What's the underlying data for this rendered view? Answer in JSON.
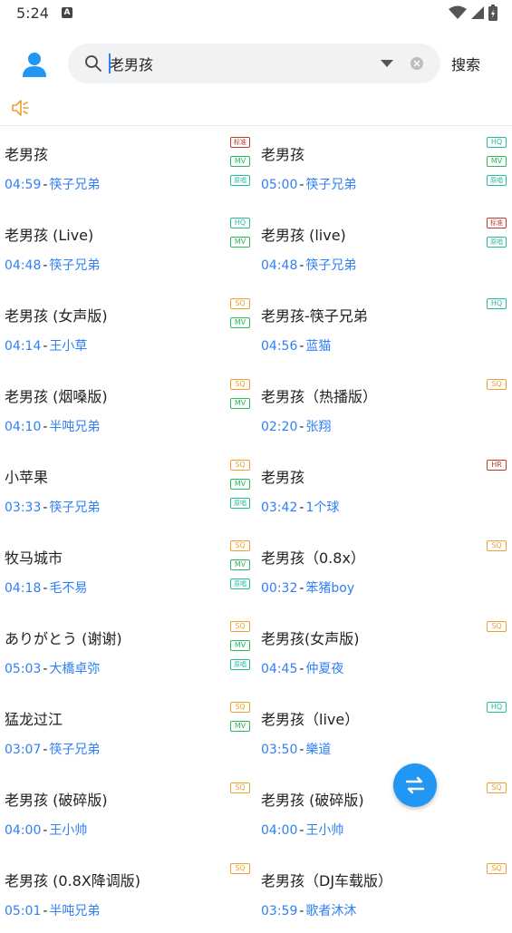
{
  "status_bar": {
    "time": "5:24",
    "notification_letter": "A"
  },
  "search": {
    "query": "老男孩",
    "button_label": "搜索"
  },
  "colors": {
    "accent": "#2f7ff5",
    "fab": "#2196f3"
  },
  "songs": [
    {
      "title": "老男孩",
      "duration": "04:59",
      "artist": "筷子兄弟",
      "badges": [
        [
          "std",
          "标准"
        ],
        [
          "mv",
          "MV"
        ],
        [
          "orig",
          "原唱"
        ]
      ]
    },
    {
      "title": "老男孩",
      "duration": "05:00",
      "artist": "筷子兄弟",
      "badges": [
        [
          "hq",
          "HQ"
        ],
        [
          "mv",
          "MV"
        ],
        [
          "orig",
          "原唱"
        ]
      ]
    },
    {
      "title": "老男孩 (Live)",
      "duration": "04:48",
      "artist": "筷子兄弟",
      "badges": [
        [
          "hq",
          "HQ"
        ],
        [
          "mv",
          "MV"
        ]
      ]
    },
    {
      "title": "老男孩 (live)",
      "duration": "04:48",
      "artist": "筷子兄弟",
      "badges": [
        [
          "std",
          "标准"
        ],
        [
          "orig",
          "原唱"
        ]
      ]
    },
    {
      "title": "老男孩 (女声版)",
      "duration": "04:14",
      "artist": "王小草",
      "badges": [
        [
          "sq",
          "SQ"
        ],
        [
          "mv",
          "MV"
        ]
      ]
    },
    {
      "title": "老男孩-筷子兄弟",
      "duration": "04:56",
      "artist": "蓝猫",
      "badges": [
        [
          "hq",
          "HQ"
        ]
      ]
    },
    {
      "title": "老男孩 (烟嗓版)",
      "duration": "04:10",
      "artist": "半吨兄弟",
      "badges": [
        [
          "sq",
          "SQ"
        ],
        [
          "mv",
          "MV"
        ]
      ]
    },
    {
      "title": "老男孩（热播版）",
      "duration": "02:20",
      "artist": "张翔",
      "badges": [
        [
          "sq",
          "SQ"
        ]
      ]
    },
    {
      "title": "小苹果",
      "duration": "03:33",
      "artist": "筷子兄弟",
      "badges": [
        [
          "sq",
          "SQ"
        ],
        [
          "mv",
          "MV"
        ],
        [
          "orig",
          "原唱"
        ]
      ]
    },
    {
      "title": "老男孩",
      "duration": "03:42",
      "artist": "1个球",
      "badges": [
        [
          "hr",
          "HR"
        ]
      ]
    },
    {
      "title": "牧马城市",
      "duration": "04:18",
      "artist": "毛不易",
      "badges": [
        [
          "sq",
          "SQ"
        ],
        [
          "mv",
          "MV"
        ],
        [
          "orig",
          "原唱"
        ]
      ]
    },
    {
      "title": "老男孩（0.8x）",
      "duration": "00:32",
      "artist": "笨猪boy",
      "badges": [
        [
          "sq",
          "SQ"
        ]
      ]
    },
    {
      "title": "ありがとう (谢谢)",
      "duration": "05:03",
      "artist": "大橋卓弥",
      "badges": [
        [
          "sq",
          "SQ"
        ],
        [
          "mv",
          "MV"
        ],
        [
          "orig",
          "原唱"
        ]
      ]
    },
    {
      "title": "老男孩(女声版)",
      "duration": "04:45",
      "artist": "仲夏夜",
      "badges": [
        [
          "sq",
          "SQ"
        ]
      ]
    },
    {
      "title": "猛龙过江",
      "duration": "03:07",
      "artist": "筷子兄弟",
      "badges": [
        [
          "sq",
          "SQ"
        ],
        [
          "mv",
          "MV"
        ]
      ]
    },
    {
      "title": "老男孩（live）",
      "duration": "03:50",
      "artist": "樂道",
      "badges": [
        [
          "hq",
          "HQ"
        ]
      ]
    },
    {
      "title": "老男孩 (破碎版)",
      "duration": "04:00",
      "artist": "王小帅",
      "badges": [
        [
          "sq",
          "SQ"
        ]
      ]
    },
    {
      "title": "老男孩 (破碎版)",
      "duration": "04:00",
      "artist": "王小帅",
      "badges": [
        [
          "sq",
          "SQ"
        ]
      ]
    },
    {
      "title": "老男孩 (0.8X降调版)",
      "duration": "05:01",
      "artist": "半吨兄弟",
      "badges": [
        [
          "sq",
          "SQ"
        ]
      ]
    },
    {
      "title": "老男孩（DJ车载版）",
      "duration": "03:59",
      "artist": "歌者沐沐",
      "badges": [
        [
          "sq",
          "SQ"
        ]
      ]
    }
  ]
}
